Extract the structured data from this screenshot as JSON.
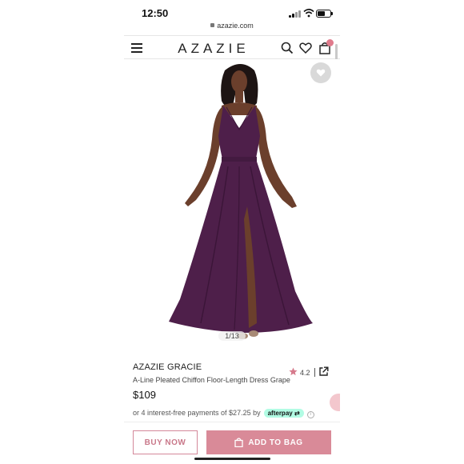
{
  "status_bar": {
    "time": "12:50",
    "battery_level": 0.6
  },
  "browser": {
    "url": "azazie.com"
  },
  "header": {
    "logo": "AZAZIE",
    "icons": [
      "menu-icon",
      "search-icon",
      "heart-icon",
      "shopping-bag-icon"
    ]
  },
  "gallery": {
    "counter": "1/13"
  },
  "product": {
    "brand": "AZAZIE GRACIE",
    "subtitle": "A-Line Pleated Chiffon Floor-Length Dress Grape",
    "price": "$109",
    "rating": "4.2",
    "installment_text": "or 4 interest-free payments of $27.25 by",
    "afterpay_label": "afterpay",
    "info_glyph": "i"
  },
  "actions": {
    "buy_now": "BUY NOW",
    "add_to_bag": "ADD TO BAG"
  },
  "colors": {
    "accent": "#d98a98",
    "accent_text": "#c9788a",
    "dress": "#4e1f4a",
    "afterpay": "#b2fce4"
  }
}
